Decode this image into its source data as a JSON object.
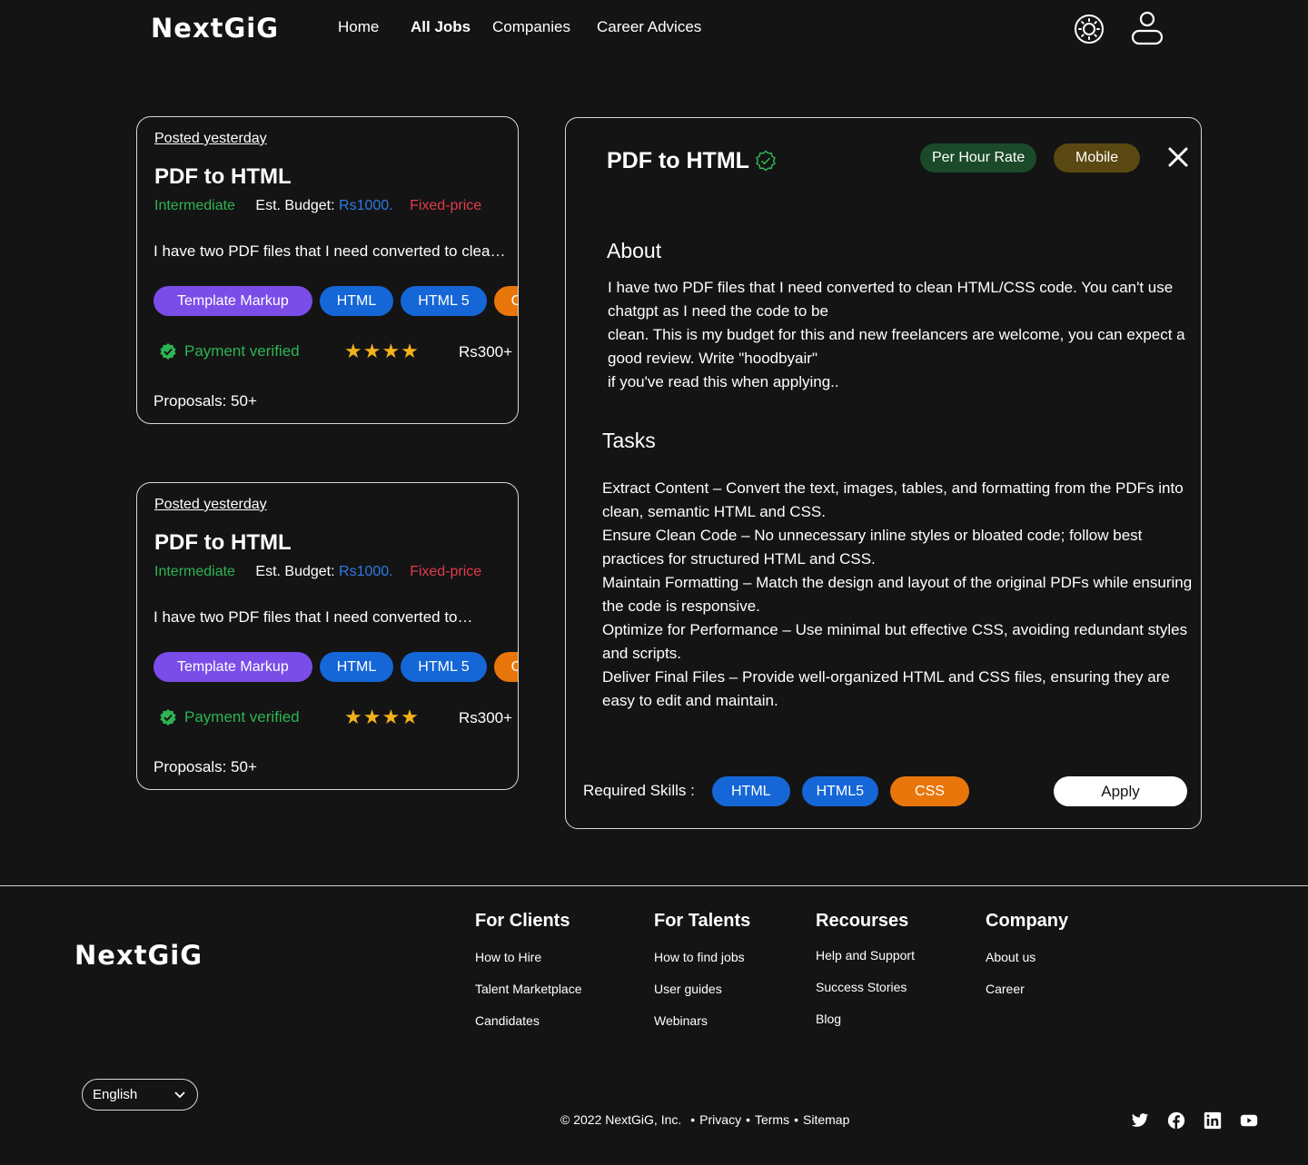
{
  "brand": "NextGiG",
  "nav": {
    "home": "Home",
    "all_jobs": "All Jobs",
    "companies": "Companies",
    "career": "Career Advices"
  },
  "jobs": [
    {
      "posted": "Posted yesterday",
      "title": "PDF to HTML",
      "level": "Intermediate",
      "budget_label": "Est. Budget:",
      "budget": "Rs1000.",
      "price_type": "Fixed-price",
      "desc": "I have two PDF files that I need converted to clean HTML/CSS code.",
      "tags": [
        "Template Markup",
        "HTML",
        "HTML 5",
        "CSS"
      ],
      "verified": "Payment verified",
      "stars": "★★★★",
      "rate": "Rs300+",
      "proposals": "Proposals: 50+"
    },
    {
      "posted": "Posted yesterday",
      "title": "PDF to HTML",
      "level": "Intermediate",
      "budget_label": "Est. Budget:",
      "budget": "Rs1000.",
      "price_type": "Fixed-price",
      "desc": "I have two PDF files that I need converted to…",
      "tags": [
        "Template Markup",
        "HTML",
        "HTML 5",
        "CSS"
      ],
      "verified": "Payment verified",
      "stars": "★★★★",
      "rate": "Rs300+",
      "proposals": "Proposals: 50+"
    }
  ],
  "detail": {
    "title": "PDF to HTML",
    "pill_rate": "Per Hour Rate",
    "pill_category": "Mobile",
    "about_heading": "About",
    "about_lines": [
      "I have two PDF files that I need converted to clean HTML/CSS code. You can't use chatgpt as I need the code to be",
      "clean. This is my budget for this and new freelancers are welcome, you can expect a good review. Write \"hoodbyair\"",
      "if you've read this when applying.."
    ],
    "tasks_heading": "Tasks",
    "tasks": [
      "Extract Content – Convert the text, images, tables, and formatting from the PDFs into clean, semantic HTML and CSS.",
      "Ensure Clean Code – No unnecessary inline styles or bloated code; follow best practices for structured HTML and CSS.",
      "Maintain Formatting – Match the design and layout of the original PDFs while ensuring the code is responsive.",
      "Optimize for Performance – Use minimal but effective CSS, avoiding redundant styles and scripts.",
      "Deliver Final Files – Provide well-organized HTML and CSS files, ensuring they are easy to edit and maintain."
    ],
    "skills_label": "Required Skills :",
    "skills": [
      "HTML",
      "HTML5",
      "CSS"
    ],
    "apply": "Apply"
  },
  "footer": {
    "clients": {
      "heading": "For Clients",
      "links": [
        "How to Hire",
        "Talent Marketplace",
        "Candidates"
      ]
    },
    "talents": {
      "heading": "For Talents",
      "links": [
        "How to find jobs",
        "User guides",
        "Webinars"
      ]
    },
    "resources": {
      "heading": "Recourses",
      "links": [
        "Help and Support",
        "Success Stories",
        "Blog"
      ]
    },
    "company": {
      "heading": "Company",
      "links": [
        "About us",
        "Career"
      ]
    },
    "language": "English",
    "copyright": "© 2022 NextGiG, Inc.",
    "privacy": "Privacy",
    "terms": "Terms",
    "sitemap": "Sitemap",
    "separator": "•"
  },
  "icons": {
    "theme": "sun-icon",
    "profile": "user-icon",
    "verify": "verified-badge-icon",
    "close": "close-icon",
    "dropdown": "chevron-down-icon",
    "social": [
      "twitter-icon",
      "facebook-icon",
      "linkedin-icon",
      "youtube-icon"
    ]
  },
  "colors": {
    "background": "#141414",
    "green": "#2db453",
    "blue": "#1566d6",
    "purple": "#7b4de8",
    "orange": "#e8760a",
    "red": "#e23b4c",
    "star": "#f2b21a"
  }
}
